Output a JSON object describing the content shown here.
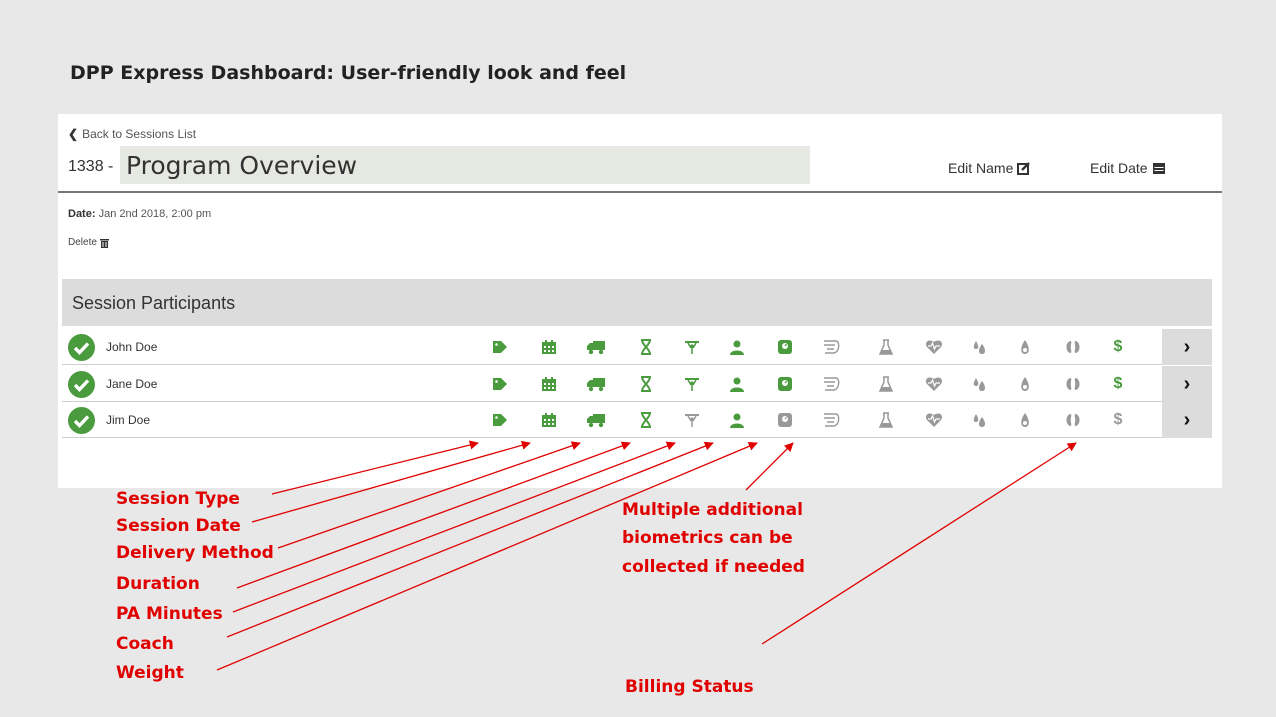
{
  "slide": {
    "title": "DPP Express Dashboard:  User-friendly look and feel"
  },
  "header": {
    "back_label": "Back to Sessions List",
    "session_number": "1338 -",
    "program_name": "Program Overview",
    "edit_name_label": "Edit Name",
    "edit_date_label": "Edit Date"
  },
  "details": {
    "date_label": "Date:",
    "date_value": "Jan 2nd 2018, 2:00 pm",
    "delete_label": "Delete"
  },
  "participants": {
    "title": "Session Participants",
    "rows": [
      {
        "name": "John Doe",
        "pa_active": true,
        "weight_active": true,
        "billed": true
      },
      {
        "name": "Jane Doe",
        "pa_active": true,
        "weight_active": true,
        "billed": true
      },
      {
        "name": "Jim Doe",
        "pa_active": false,
        "weight_active": false,
        "billed": false
      }
    ],
    "icons": [
      "tag-icon",
      "calendar-icon",
      "truck-icon",
      "hourglass-icon",
      "dumbbell-icon",
      "user-icon",
      "scale-icon",
      "hand-icon",
      "flask-icon",
      "heart-rate-icon",
      "blood-drops-icon",
      "blood-drop-icon",
      "kidneys-icon",
      "dollar-icon"
    ],
    "dollar_glyph": "$",
    "next_glyph": "›"
  },
  "annotations": {
    "left_labels": [
      "Session Type",
      "Session Date",
      "Delivery Method",
      "Duration",
      "PA Minutes",
      "Coach",
      "Weight"
    ],
    "biometrics_lines": [
      "Multiple additional",
      "biometrics can be",
      "collected if needed"
    ],
    "billing_label": "Billing Status"
  },
  "colors": {
    "accent_green": "#4a9a3e",
    "inactive_gray": "#999999",
    "annotation_red": "#e00000"
  }
}
